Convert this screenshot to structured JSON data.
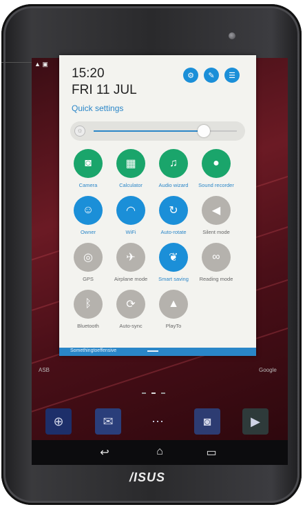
{
  "device": {
    "brand": "/ISUS"
  },
  "quick_settings": {
    "time": "15:20",
    "date": "FRI 11 JUL",
    "title": "Quick settings",
    "header_buttons": [
      {
        "name": "settings",
        "icon": "gear-icon",
        "glyph": "⚙"
      },
      {
        "name": "edit",
        "icon": "edit-icon",
        "glyph": "✎"
      },
      {
        "name": "list",
        "icon": "list-icon",
        "glyph": "☰"
      }
    ],
    "brightness_level": 0.77,
    "tiles": [
      {
        "label": "Camera",
        "icon": "camera-icon",
        "glyph": "◙",
        "state": "green"
      },
      {
        "label": "Calculator",
        "icon": "calculator-icon",
        "glyph": "▦",
        "state": "green"
      },
      {
        "label": "Audio wizard",
        "icon": "audio-wizard-icon",
        "glyph": "♫",
        "state": "green"
      },
      {
        "label": "Sound recorder",
        "icon": "microphone-icon",
        "glyph": "●",
        "state": "green"
      },
      {
        "label": "Owner",
        "icon": "avatar-icon",
        "glyph": "☺",
        "state": "blue"
      },
      {
        "label": "WiFi",
        "icon": "wifi-icon",
        "glyph": "◠",
        "state": "blue"
      },
      {
        "label": "Auto-rotate",
        "icon": "rotate-icon",
        "glyph": "↻",
        "state": "blue"
      },
      {
        "label": "Silent mode",
        "icon": "speaker-mute-icon",
        "glyph": "◀",
        "state": "gray"
      },
      {
        "label": "GPS",
        "icon": "gps-icon",
        "glyph": "◎",
        "state": "gray"
      },
      {
        "label": "Airplane mode",
        "icon": "airplane-icon",
        "glyph": "✈",
        "state": "gray"
      },
      {
        "label": "Smart saving",
        "icon": "leaf-icon",
        "glyph": "❦",
        "state": "blue"
      },
      {
        "label": "Reading mode",
        "icon": "glasses-icon",
        "glyph": "∞",
        "state": "gray"
      },
      {
        "label": "Bluetooth",
        "icon": "bluetooth-icon",
        "glyph": "ᛒ",
        "state": "gray"
      },
      {
        "label": "Auto-sync",
        "icon": "sync-icon",
        "glyph": "⟳",
        "state": "gray"
      },
      {
        "label": "PlayTo",
        "icon": "playto-icon",
        "glyph": "▲",
        "state": "gray"
      }
    ],
    "notification_text": "Somethingtoeffensive"
  },
  "desktop": {
    "left_label": "ASB",
    "right_label": "Google",
    "dock": [
      {
        "icon": "browser-icon",
        "glyph": "⊕"
      },
      {
        "icon": "mail-icon",
        "glyph": "✉"
      },
      {
        "icon": "app-drawer-icon",
        "glyph": "⋯"
      },
      {
        "icon": "camera-icon",
        "glyph": "◙"
      },
      {
        "icon": "play-store-icon",
        "glyph": "▶"
      }
    ]
  },
  "navbar": {
    "back_glyph": "↩",
    "home_glyph": "⌂",
    "recents_glyph": "▭"
  },
  "colors": {
    "green": "#1aa56b",
    "blue": "#1b8fd8",
    "gray": "#b5b2ad",
    "label_blue": "#2a86c8",
    "label_gray": "#666666"
  }
}
